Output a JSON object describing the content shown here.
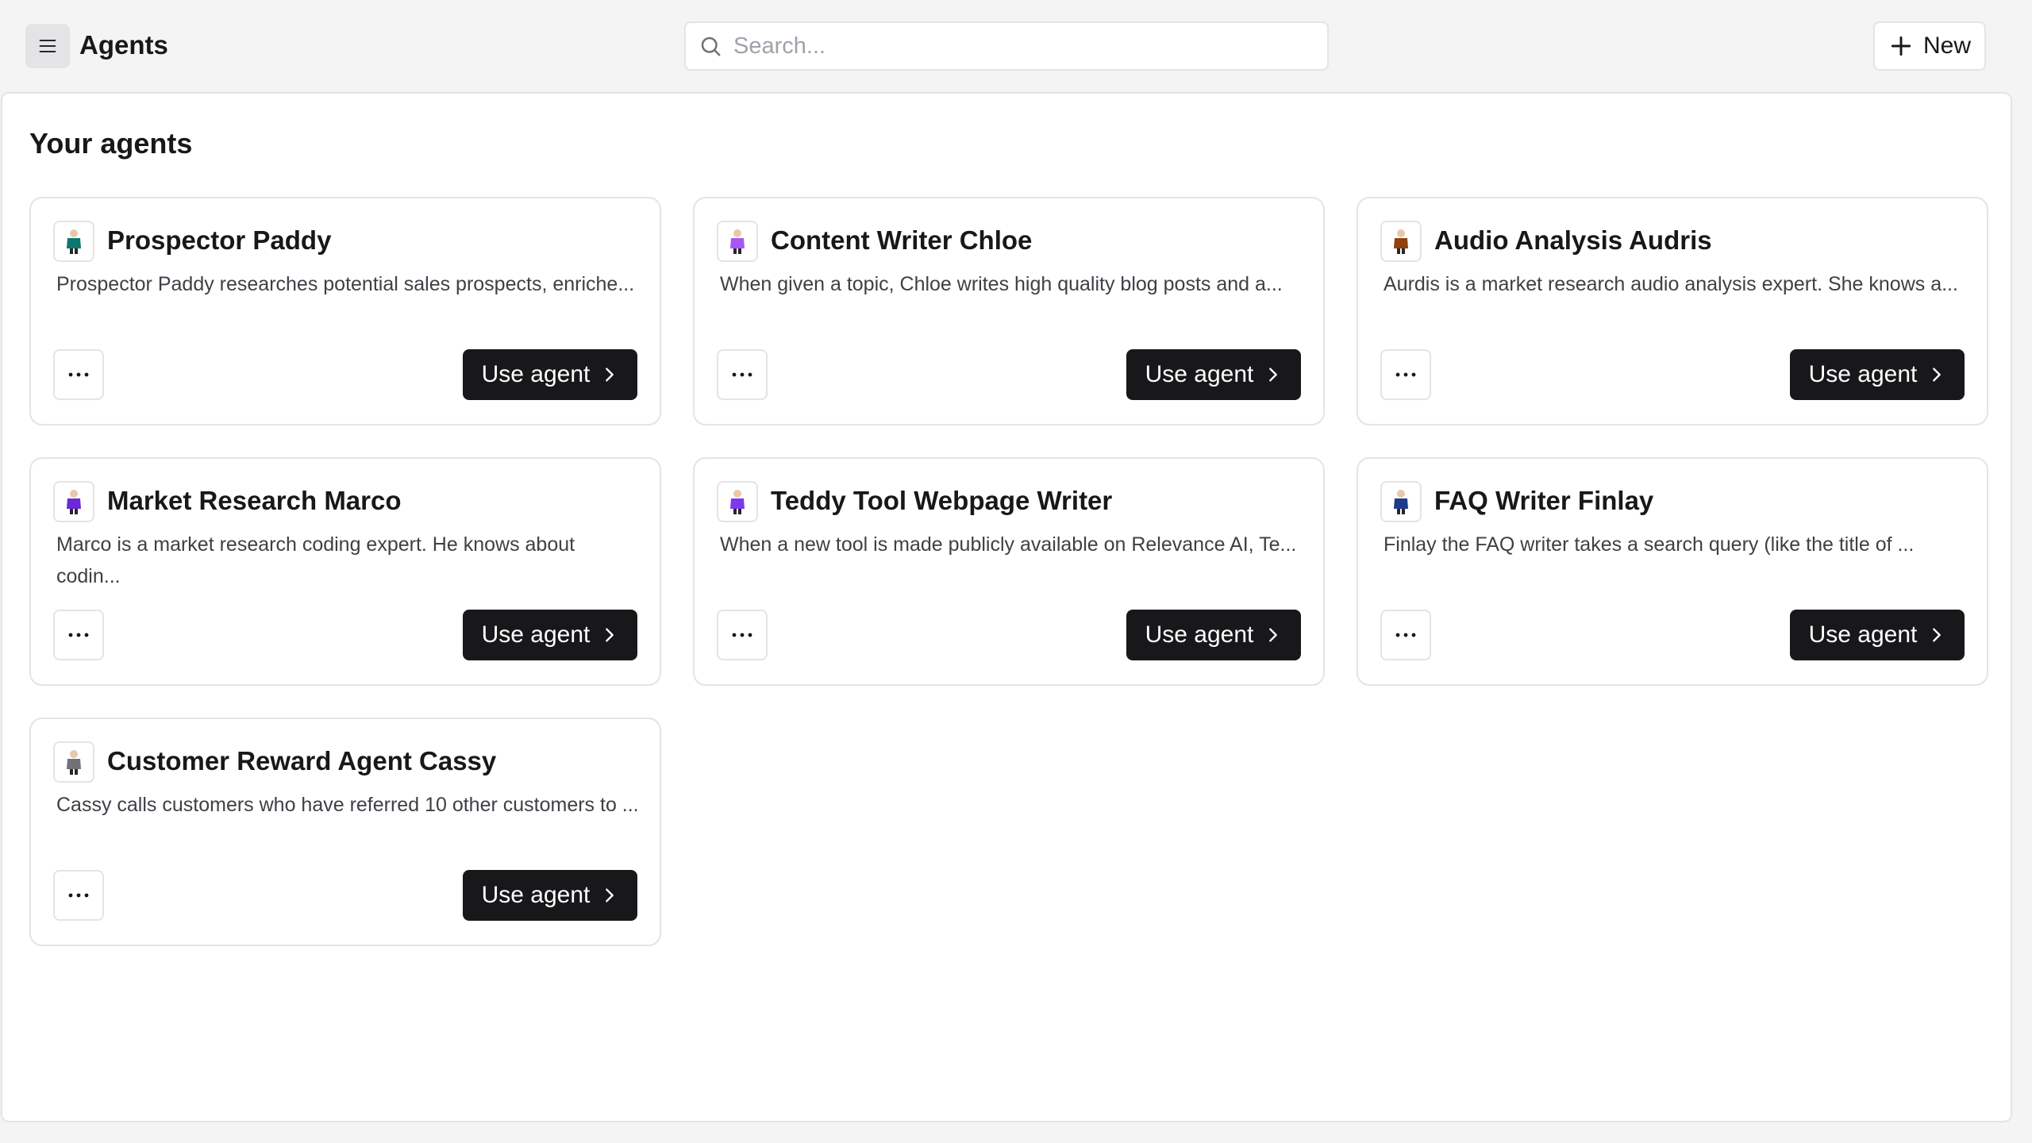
{
  "header": {
    "title": "Agents",
    "search_placeholder": "Search...",
    "new_label": "New"
  },
  "main": {
    "section_title": "Your agents",
    "agents": [
      {
        "name": "Prospector Paddy",
        "description": "Prospector Paddy researches potential sales prospects, enriche...",
        "action": "Use agent",
        "avatar_color": "#0f766e"
      },
      {
        "name": "Content Writer Chloe",
        "description": "When given a topic, Chloe writes high quality blog posts and a...",
        "action": "Use agent",
        "avatar_color": "#a855f7"
      },
      {
        "name": "Audio Analysis Audris",
        "description": "Aurdis is a market research audio analysis expert. She knows a...",
        "action": "Use agent",
        "avatar_color": "#92400e"
      },
      {
        "name": "Market Research Marco",
        "description": "Marco is a market research coding expert. He knows about codin...",
        "action": "Use agent",
        "avatar_color": "#6d28d9"
      },
      {
        "name": "Teddy Tool Webpage Writer",
        "description": "When a new tool is made publicly available on Relevance AI, Te...",
        "action": "Use agent",
        "avatar_color": "#7c3aed"
      },
      {
        "name": "FAQ Writer Finlay",
        "description": "Finlay the FAQ writer takes a search query (like the title of ...",
        "action": "Use agent",
        "avatar_color": "#1e3a8a"
      },
      {
        "name": "Customer Reward Agent Cassy",
        "description": "Cassy calls customers who have referred 10 other customers to ...",
        "action": "Use agent",
        "avatar_color": "#71717a"
      }
    ]
  },
  "icons": {
    "menu": "menu-icon",
    "search": "search-icon",
    "new": "plus-icon",
    "more": "more-horizontal-icon",
    "use": "chevron-right-icon",
    "avatar": "agent-avatar-icon"
  }
}
